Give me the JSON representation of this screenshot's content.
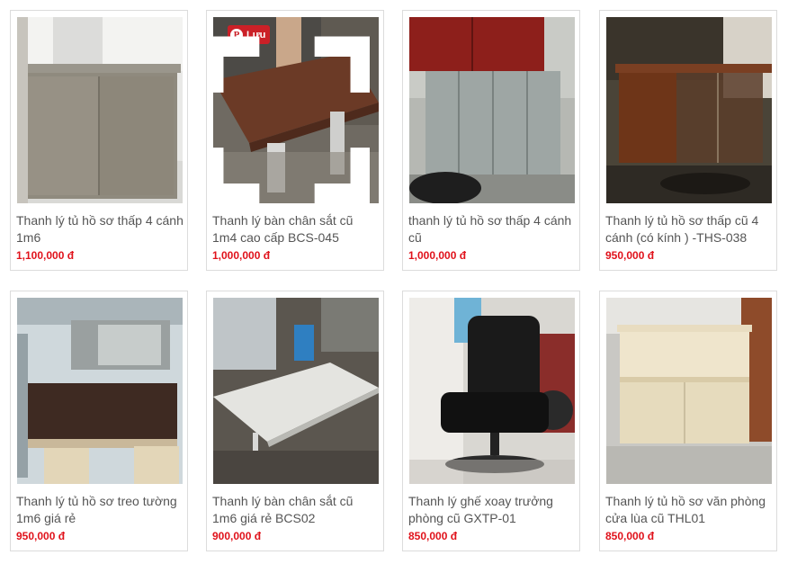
{
  "products": [
    {
      "title": "Thanh lý tủ hồ sơ thấp 4 cánh 1m6",
      "price": "1,100,000 đ"
    },
    {
      "title": "Thanh lý bàn chân sắt cũ 1m4 cao cấp BCS-045",
      "price": "1,000,000 đ"
    },
    {
      "title": "thanh lý tủ hồ sơ thấp 4 cánh cũ",
      "price": "1,000,000 đ"
    },
    {
      "title": "Thanh lý tủ hồ sơ thấp cũ 4 cánh (có kính ) -THS-038",
      "price": "950,000 đ"
    },
    {
      "title": "Thanh lý tủ hồ sơ treo tường 1m6 giá rẻ",
      "price": "950,000 đ"
    },
    {
      "title": "Thanh lý bàn chân sắt cũ 1m6 giá rẻ BCS02",
      "price": "900,000 đ"
    },
    {
      "title": "Thanh lý ghế xoay trưởng phòng cũ GXTP-01",
      "price": "850,000 đ"
    },
    {
      "title": "Thanh lý tủ hồ sơ văn phòng cửa lùa cũ THL01",
      "price": "850,000 đ"
    }
  ],
  "pinterest": {
    "label": "Lưu",
    "logo": "P",
    "icon": "pinterest-icon"
  },
  "expand": {
    "icon": "expand-icon"
  },
  "colors": {
    "price": "#e0121b",
    "title": "#555555",
    "border": "#dcdcdc",
    "pinterest": "#cb2027"
  }
}
